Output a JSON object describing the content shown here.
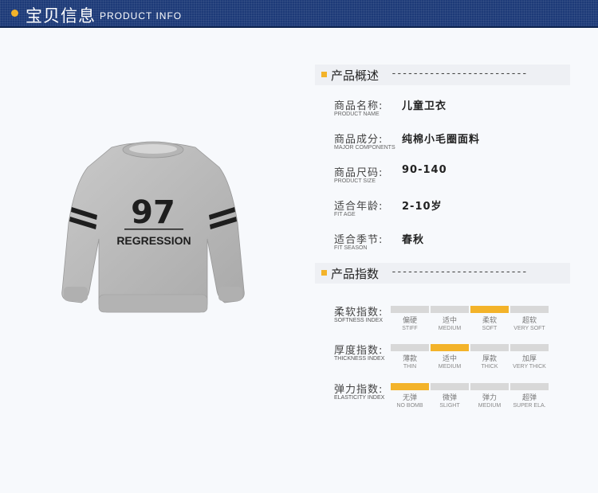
{
  "header": {
    "title_cn": "宝贝信息",
    "title_en": "PRODUCT INFO"
  },
  "product_image": {
    "number": "97",
    "text": "REGRESSION"
  },
  "overview": {
    "heading": "产品概述",
    "dashes": "-------------------------",
    "rows": [
      {
        "label_cn": "商品名称:",
        "label_en": "PRODUCT NAME",
        "value": "儿童卫衣"
      },
      {
        "label_cn": "商品成分:",
        "label_en": "MAJOR COMPONENTS",
        "value": "纯棉小毛圈面料"
      },
      {
        "label_cn": "商品尺码:",
        "label_en": "PRODUCT SIZE",
        "value": "90-140"
      },
      {
        "label_cn": "适合年龄:",
        "label_en": "FIT AGE",
        "value": "2-10岁"
      },
      {
        "label_cn": "适合季节:",
        "label_en": "FIT SEASON",
        "value": "春秋"
      }
    ]
  },
  "indexes": {
    "heading": "产品指数",
    "dashes": "-------------------------",
    "rows": [
      {
        "label_cn": "柔软指数:",
        "label_en": "SOFTNESS INDEX",
        "active": 2,
        "options": [
          {
            "cn": "偏硬",
            "en": "STIFF"
          },
          {
            "cn": "适中",
            "en": "MEDIUM"
          },
          {
            "cn": "柔软",
            "en": "SOFT"
          },
          {
            "cn": "超软",
            "en": "VERY SOFT"
          }
        ]
      },
      {
        "label_cn": "厚度指数:",
        "label_en": "THICKNESS INDEX",
        "active": 1,
        "options": [
          {
            "cn": "薄款",
            "en": "THIN"
          },
          {
            "cn": "适中",
            "en": "MEDIUM"
          },
          {
            "cn": "厚款",
            "en": "THICK"
          },
          {
            "cn": "加厚",
            "en": "VERY THICK"
          }
        ]
      },
      {
        "label_cn": "弹力指数:",
        "label_en": "ELASTICITY INDEX",
        "active": 0,
        "options": [
          {
            "cn": "无弹",
            "en": "NO BOMB"
          },
          {
            "cn": "微弹",
            "en": "SLIGHT"
          },
          {
            "cn": "弹力",
            "en": "MEDIUM"
          },
          {
            "cn": "超弹",
            "en": "SUPER ELA."
          }
        ]
      }
    ]
  },
  "colors": {
    "header_bg": "#1d3a78",
    "accent": "#f3b32a",
    "bar_inactive": "#d8d8d8"
  }
}
